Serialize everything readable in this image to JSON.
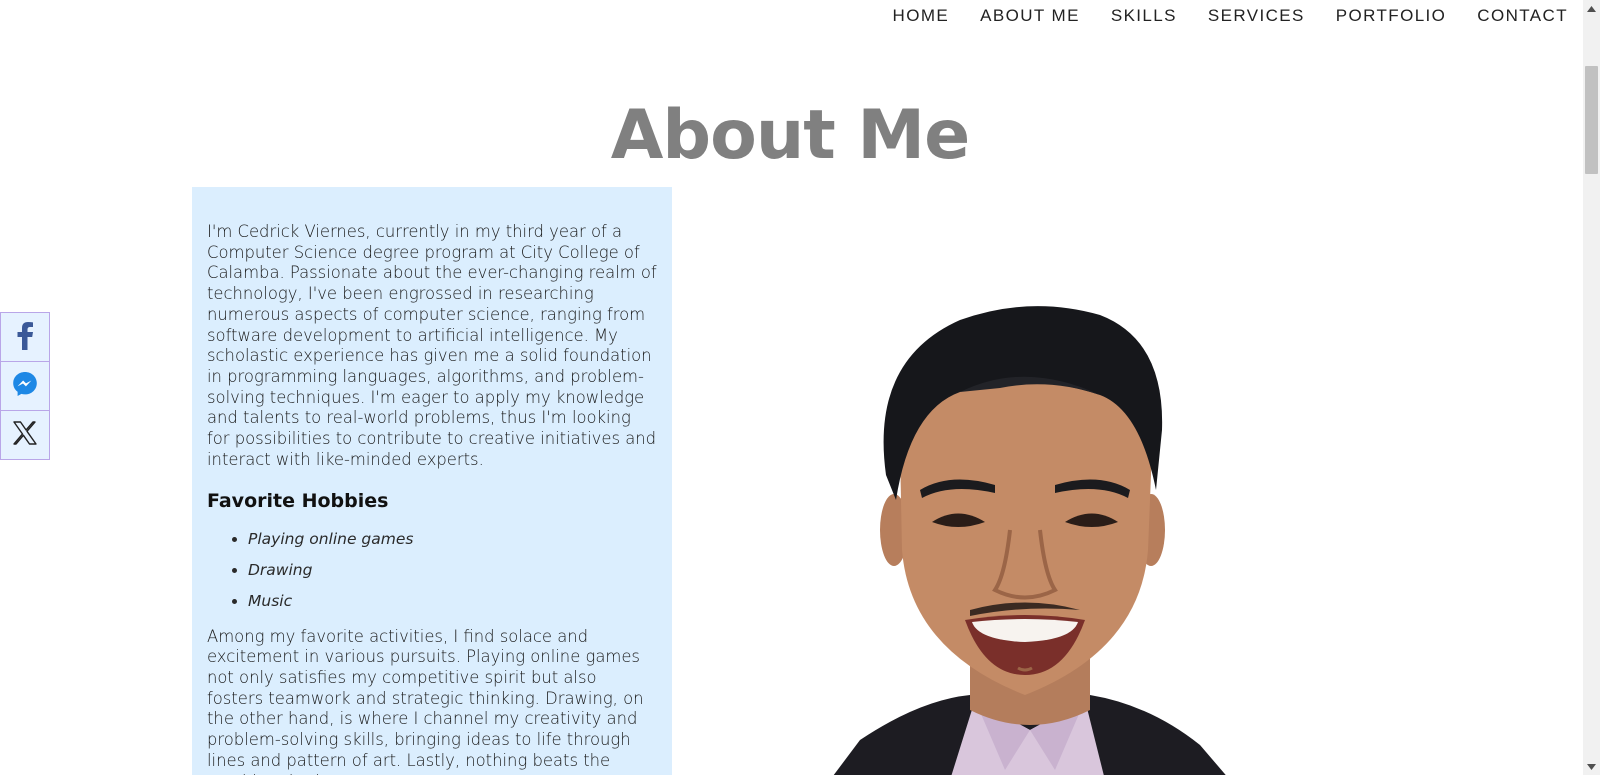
{
  "nav": {
    "items": [
      "HOME",
      "ABOUT ME",
      "SKILLS",
      "SERVICES",
      "PORTFOLIO",
      "CONTACT"
    ]
  },
  "page": {
    "title": "About Me"
  },
  "bio": {
    "intro": "I'm Cedrick Viernes, currently in my third year of a Computer Science degree program at City College of Calamba. Passionate about the ever-changing realm of technology, I've been engrossed in researching numerous aspects of computer science, ranging from software development to artificial intelligence. My scholastic experience has given me a solid foundation in programming languages, algorithms, and problem-solving techniques. I'm eager to apply my knowledge and talents to real-world problems, thus I'm looking for possibilities to contribute to creative initiatives and interact with like-minded experts.",
    "hobbies_heading": "Favorite Hobbies",
    "hobbies": [
      "Playing online games",
      "Drawing",
      "Music"
    ],
    "hobbies_text": "Among my favorite activities, I find solace and excitement in various pursuits. Playing online games not only satisfies my competitive spirit but also fosters teamwork and strategic thinking. Drawing, on the other hand, is where I channel my creativity and problem-solving skills, bringing ideas to life through lines and pattern of art. Lastly, nothing beats the soothing rhythm"
  },
  "share": {
    "buttons": [
      "facebook-icon",
      "messenger-icon",
      "x-icon"
    ]
  },
  "colors": {
    "panel_bg": "#dbeefe",
    "title": "#808080",
    "facebook": "#3b5998",
    "messenger": "#1e88e5"
  }
}
